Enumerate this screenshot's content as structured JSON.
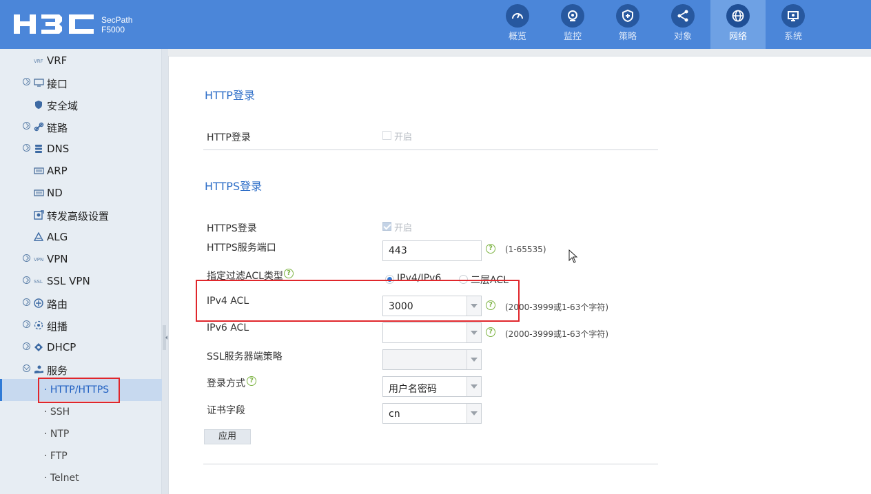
{
  "header": {
    "product_line1": "SecPath",
    "product_line2": "F5000",
    "nav": [
      {
        "label": "概览",
        "icon": "gauge-icon"
      },
      {
        "label": "监控",
        "icon": "camera-icon"
      },
      {
        "label": "策略",
        "icon": "shield-plus-icon"
      },
      {
        "label": "对象",
        "icon": "share-icon"
      },
      {
        "label": "网络",
        "icon": "globe-icon",
        "active": true
      },
      {
        "label": "系统",
        "icon": "monitor-icon"
      }
    ]
  },
  "sidebar": {
    "items": [
      {
        "label": "VRF"
      },
      {
        "label": "接口"
      },
      {
        "label": "安全域"
      },
      {
        "label": "链路"
      },
      {
        "label": "DNS"
      },
      {
        "label": "ARP"
      },
      {
        "label": "ND"
      },
      {
        "label": "转发高级设置"
      },
      {
        "label": "ALG"
      },
      {
        "label": "VPN"
      },
      {
        "label": "SSL VPN"
      },
      {
        "label": "路由"
      },
      {
        "label": "组播"
      },
      {
        "label": "DHCP"
      },
      {
        "label": "服务"
      }
    ],
    "sub_items": [
      {
        "label": "· HTTP/HTTPS",
        "selected": true
      },
      {
        "label": "· SSH"
      },
      {
        "label": "· NTP"
      },
      {
        "label": "· FTP"
      },
      {
        "label": "· Telnet"
      }
    ]
  },
  "http": {
    "title": "HTTP登录",
    "login_label": "HTTP登录",
    "enable_label": "开启",
    "enabled": false
  },
  "https": {
    "title": "HTTPS登录",
    "login_label": "HTTPS登录",
    "enable_label": "开启",
    "enabled": true,
    "port_label": "HTTPS服务端口",
    "port_value": "443",
    "port_hint": "(1-65535)",
    "acl_type_label": "指定过滤ACL类型",
    "acl_type_options": [
      "IPv4/IPv6",
      "二层ACL"
    ],
    "acl_type_selected": "IPv4/IPv6",
    "ipv4_acl_label": "IPv4 ACL",
    "ipv4_acl_value": "3000",
    "ipv4_acl_hint": "(2000-3999或1-63个字符)",
    "ipv6_acl_label": "IPv6 ACL",
    "ipv6_acl_value": "",
    "ipv6_acl_hint": "(2000-3999或1-63个字符)",
    "ssl_policy_label": "SSL服务器端策略",
    "ssl_policy_value": "",
    "login_mode_label": "登录方式",
    "login_mode_value": "用户名密码",
    "cert_field_label": "证书字段",
    "cert_field_value": "cn",
    "apply_label": "应用"
  },
  "help_glyph": "?",
  "colors": {
    "header_bg": "#4b86d9",
    "accent": "#2f6fc8",
    "highlight_border": "#e0262b",
    "help_green": "#7cb342"
  }
}
